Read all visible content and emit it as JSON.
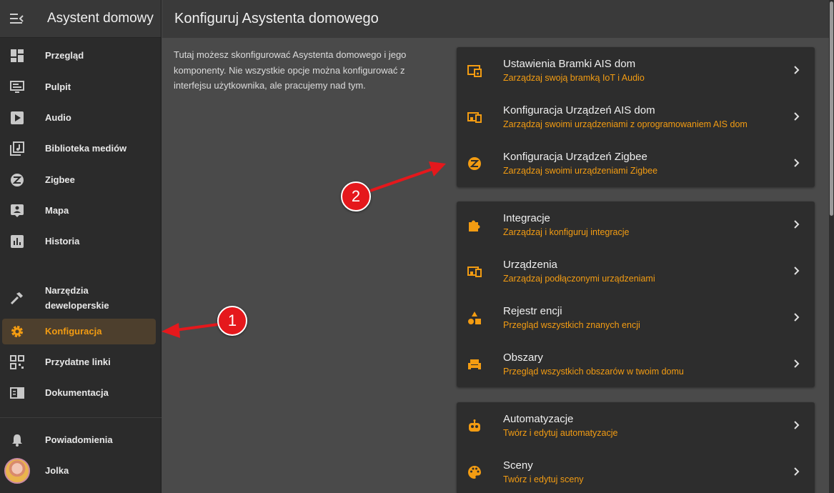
{
  "sidebar": {
    "title": "Asystent domowy",
    "items": [
      {
        "label": "Przegląd",
        "icon": "dashboard-icon"
      },
      {
        "label": "Pulpit",
        "icon": "monitor-icon"
      },
      {
        "label": "Audio",
        "icon": "play-icon"
      },
      {
        "label": "Biblioteka mediów",
        "icon": "music-library-icon"
      },
      {
        "label": "Zigbee",
        "icon": "zigbee-icon"
      },
      {
        "label": "Mapa",
        "icon": "map-person-icon"
      },
      {
        "label": "Historia",
        "icon": "chart-icon"
      }
    ],
    "dev_tools": {
      "line1": "Narzędzia",
      "line2": "deweloperskie"
    },
    "config": {
      "label": "Konfiguracja"
    },
    "links": {
      "label": "Przydatne linki"
    },
    "docs": {
      "label": "Dokumentacja"
    },
    "notifications": {
      "label": "Powiadomienia"
    },
    "user": {
      "label": "Jolka"
    }
  },
  "header": {
    "title": "Konfiguruj Asystenta domowego"
  },
  "intro": "Tutaj możesz skonfigurować Asystenta domowego i jego komponenty. Nie wszystkie opcje można konfigurować z interfejsu użytkownika, ale pracujemy nad tym.",
  "cards": [
    {
      "rows": [
        {
          "title": "Ustawienia Bramki AIS dom",
          "subtitle": "Zarządzaj swoją bramką IoT i Audio",
          "icon": "gateway-icon"
        },
        {
          "title": "Konfiguracja Urządzeń AIS dom",
          "subtitle": "Zarządzaj swoimi urządzeniami z oprogramowaniem AIS dom",
          "icon": "devices-icon"
        },
        {
          "title": "Konfiguracja Urządzeń Zigbee",
          "subtitle": "Zarządzaj swoimi urządzeniami Zigbee",
          "icon": "zigbee-icon"
        }
      ]
    },
    {
      "rows": [
        {
          "title": "Integracje",
          "subtitle": "Zarządzaj i konfiguruj integracje",
          "icon": "puzzle-icon"
        },
        {
          "title": "Urządzenia",
          "subtitle": "Zarządzaj podłączonymi urządzeniami",
          "icon": "devices-icon"
        },
        {
          "title": "Rejestr encji",
          "subtitle": "Przegląd wszystkich znanych encji",
          "icon": "shapes-icon"
        },
        {
          "title": "Obszary",
          "subtitle": "Przegląd wszystkich obszarów w twoim domu",
          "icon": "sofa-icon"
        }
      ]
    },
    {
      "rows": [
        {
          "title": "Automatyzacje",
          "subtitle": "Twórz i edytuj automatyzacje",
          "icon": "robot-icon"
        },
        {
          "title": "Sceny",
          "subtitle": "Twórz i edytuj sceny",
          "icon": "palette-icon"
        }
      ]
    }
  ],
  "annotations": {
    "badge1": "1",
    "badge2": "2"
  },
  "colors": {
    "accent": "#f39c12",
    "annotation": "#e5181c"
  }
}
